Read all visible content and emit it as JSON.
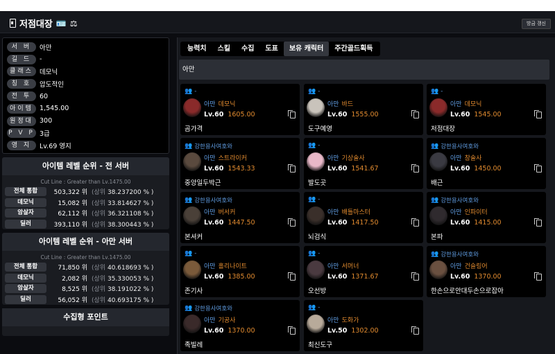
{
  "header": {
    "title": "저점대장",
    "refresh_label": "방금 갱신"
  },
  "info": [
    {
      "label": "서 버",
      "value": "아만"
    },
    {
      "label": "길 드",
      "value": "-"
    },
    {
      "label": "클래스",
      "value": "데모닉"
    },
    {
      "label": "칭 호",
      "value": "압도적인"
    },
    {
      "label": "전 투",
      "value": "60"
    },
    {
      "label": "아이템",
      "value": "1,545.00"
    },
    {
      "label": "원정대",
      "value": "300"
    },
    {
      "label": "P V P",
      "value": "3급"
    },
    {
      "label": "영 지",
      "value": "Lv.69 영지"
    }
  ],
  "rank_all": {
    "title": "아이템 레벨 순위 - 전 서버",
    "cut": "Cut Line : Greater than Lv.1475.00",
    "rows": [
      {
        "cls": "전체 통합",
        "num": "503,322 위",
        "pct_pre": "(상위",
        "pct": "38.237200 % )"
      },
      {
        "cls": "데모닉",
        "num": "15,082 위",
        "pct_pre": "(상위",
        "pct": "33.814627 % )"
      },
      {
        "cls": "암살자",
        "num": "62,112 위",
        "pct_pre": "(상위",
        "pct": "36.321108 % )"
      },
      {
        "cls": "딜러",
        "num": "393,110 위",
        "pct_pre": "(상위",
        "pct": "38.300443 % )"
      }
    ]
  },
  "rank_server": {
    "title": "아이템 레벨 순위 - 아만 서버",
    "cut": "Cut Line : Greater than Lv.1475.00",
    "rows": [
      {
        "cls": "전체 통합",
        "num": "71,850 위",
        "pct_pre": "(상위",
        "pct": "40.618693 % )"
      },
      {
        "cls": "데모닉",
        "num": "2,082 위",
        "pct_pre": "(상위",
        "pct": "35.330053 % )"
      },
      {
        "cls": "암살자",
        "num": "8,525 위",
        "pct_pre": "(상위",
        "pct": "38.191022 % )"
      },
      {
        "cls": "딜러",
        "num": "56,052 위",
        "pct_pre": "(상위",
        "pct": "40.693175 % )"
      }
    ]
  },
  "collection": {
    "title": "수집형 포인트"
  },
  "tabs": [
    "능력치",
    "스킬",
    "수집",
    "도표",
    "보유 캐릭터",
    "주간골드획득"
  ],
  "active_tab": 4,
  "server_header": "아만",
  "characters": [
    {
      "guild": "-",
      "server": "아만",
      "cls": "데모닉",
      "lv": "Lv.60",
      "ilvl": "1605.00",
      "name": "곰가격",
      "av": "#8a2a2a"
    },
    {
      "guild": "-",
      "server": "아만",
      "cls": "바드",
      "lv": "Lv.60",
      "ilvl": "1555.00",
      "name": "도구예영",
      "av": "#c9c3bb"
    },
    {
      "guild": "-",
      "server": "아만",
      "cls": "데모닉",
      "lv": "Lv.60",
      "ilvl": "1545.00",
      "name": "저점대장",
      "av": "#8a2a2a"
    },
    {
      "guild": "강한용사여호와",
      "server": "아만",
      "cls": "스트라이커",
      "lv": "Lv.60",
      "ilvl": "1543.33",
      "name": "중앙일두박근",
      "av": "#5a4a3e"
    },
    {
      "guild": "-",
      "server": "아만",
      "cls": "기상술사",
      "lv": "Lv.60",
      "ilvl": "1541.67",
      "name": "발도곳",
      "av": "#e8b8c8"
    },
    {
      "guild": "강한용사여호와",
      "server": "아만",
      "cls": "창술사",
      "lv": "Lv.60",
      "ilvl": "1450.00",
      "name": "배근",
      "av": "#3a3a42"
    },
    {
      "guild": "강한용사여호와",
      "server": "아만",
      "cls": "버서커",
      "lv": "Lv.60",
      "ilvl": "1447.50",
      "name": "본셔커",
      "av": "#4a4038"
    },
    {
      "guild": "-",
      "server": "아만",
      "cls": "배틀마스터",
      "lv": "Lv.60",
      "ilvl": "1417.50",
      "name": "뇌검식",
      "av": "#3a2f2a"
    },
    {
      "guild": "강한용사여호와",
      "server": "아만",
      "cls": "인파이터",
      "lv": "Lv.60",
      "ilvl": "1415.00",
      "name": "본파",
      "av": "#2f2a2e"
    },
    {
      "guild": "-",
      "server": "아만",
      "cls": "홀리나이트",
      "lv": "Lv.60",
      "ilvl": "1385.00",
      "name": "존기사",
      "av": "#7a5a3a"
    },
    {
      "guild": "-",
      "server": "아만",
      "cls": "서머너",
      "lv": "Lv.60",
      "ilvl": "1371.67",
      "name": "오선방",
      "av": "#4a3a40"
    },
    {
      "guild": "강한용사여호와",
      "server": "아만",
      "cls": "건슬링어",
      "lv": "Lv.60",
      "ilvl": "1370.00",
      "name": "한손으로안대두손으로잡아",
      "av": "#6a5040"
    },
    {
      "guild": "강한용사여호와",
      "server": "아만",
      "cls": "기공사",
      "lv": "Lv.60",
      "ilvl": "1370.00",
      "name": "족빌레",
      "av": "#3a2a2a"
    },
    {
      "guild": "-",
      "server": "아만",
      "cls": "도화가",
      "lv": "Lv.50",
      "ilvl": "1302.00",
      "name": "최신도구",
      "av": "#b8aa9a"
    }
  ]
}
